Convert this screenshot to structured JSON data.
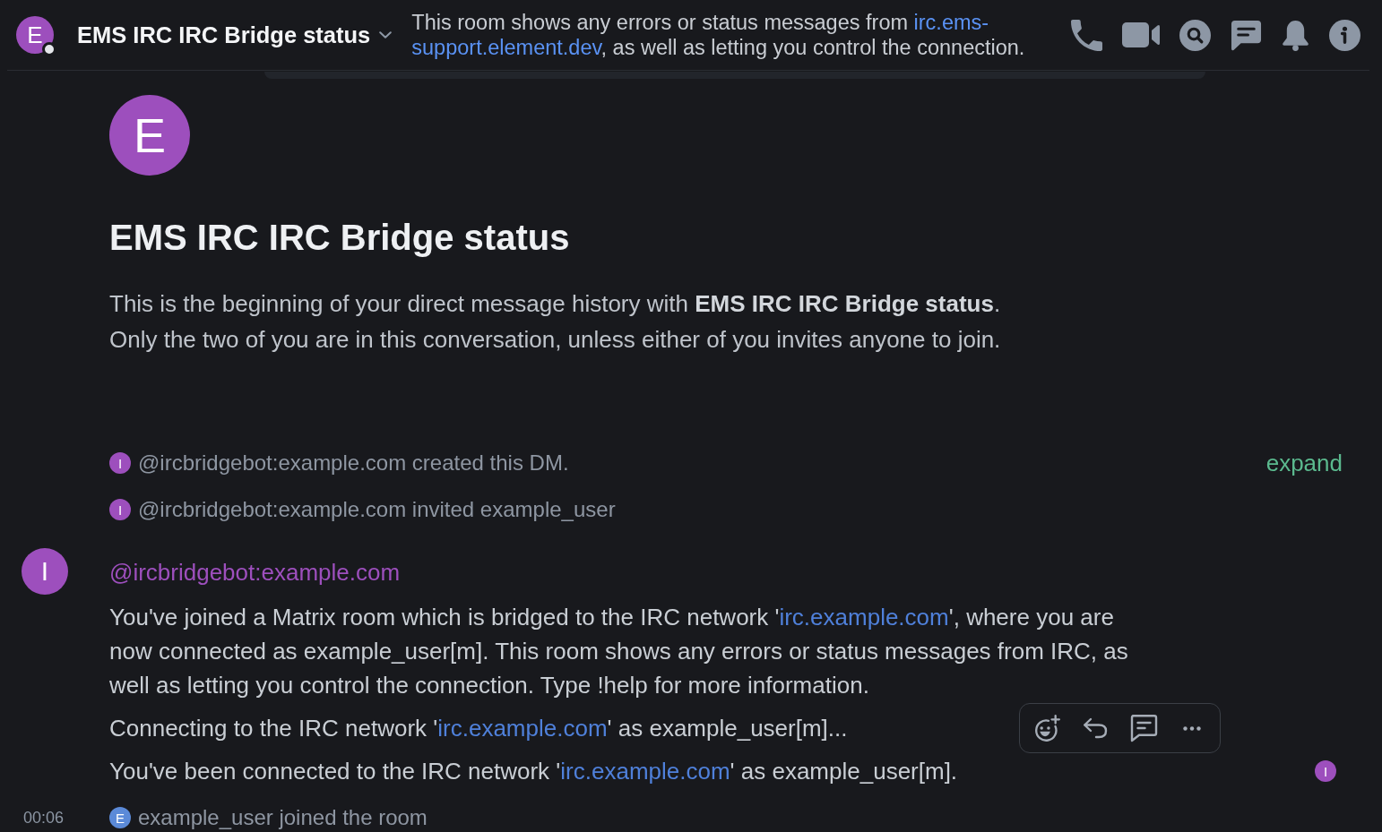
{
  "room_header": {
    "avatar": {
      "letter": "E",
      "online": false
    },
    "name": "EMS IRC IRC Bridge status",
    "topic": [
      {
        "kind": "text",
        "text": "This room shows any errors or status messages from "
      },
      {
        "kind": "link",
        "text": "irc.ems-"
      },
      {
        "kind": "link",
        "text": "support.element.dev"
      },
      {
        "kind": "text",
        "text": ", as well as letting you control the connection."
      }
    ]
  },
  "intro": {
    "avatar_letter": "E",
    "title": "EMS IRC IRC Bridge status",
    "lines": [
      "This is the beginning of your direct message history with **EMS IRC IRC Bridge status**.",
      "Only the two of you are in this conversation, unless either of you invites anyone to join."
    ]
  },
  "timeline": [
    {
      "kind": "event",
      "avatar": {
        "letter": "I",
        "color": "#9d4fbd"
      },
      "text": "@ircbridgebot:example.com created this DM.",
      "action": "expand"
    },
    {
      "kind": "event",
      "avatar": {
        "letter": "I",
        "color": "#9d4fbd"
      },
      "text": "@ircbridgebot:example.com invited example_user"
    },
    {
      "kind": "message_group",
      "avatar": {
        "letter": "I",
        "color": "#9d4fbd"
      },
      "sender": "@ircbridgebot:example.com",
      "messages": [
        {
          "hovered": false,
          "body": [
            {
              "kind": "text",
              "text": "You've joined a Matrix room which is bridged to the IRC network '"
            },
            {
              "kind": "link",
              "text": "irc.example.com"
            },
            {
              "kind": "text",
              "text": "', where you are now connected as example_user[m]. This room shows any errors or status messages from IRC, as well as letting you control the connection. Type !help for more information."
            }
          ]
        },
        {
          "hovered": true,
          "body": [
            {
              "kind": "text",
              "text": "Connecting to the IRC network '"
            },
            {
              "kind": "link",
              "text": "irc.example.com"
            },
            {
              "kind": "text",
              "text": "' as example_user[m]..."
            }
          ]
        },
        {
          "hovered": false,
          "body": [
            {
              "kind": "text",
              "text": "You've been connected to the IRC network '"
            },
            {
              "kind": "link",
              "text": "irc.example.com"
            },
            {
              "kind": "text",
              "text": "' as example_user[m]."
            }
          ],
          "read_receipts": [
            {
              "letter": "I",
              "color": "#9d4fbd"
            }
          ]
        }
      ]
    },
    {
      "kind": "event",
      "time": "00:06",
      "avatar": {
        "letter": "E",
        "color": "#5b8ad8"
      },
      "text": "example_user joined the room"
    }
  ]
}
